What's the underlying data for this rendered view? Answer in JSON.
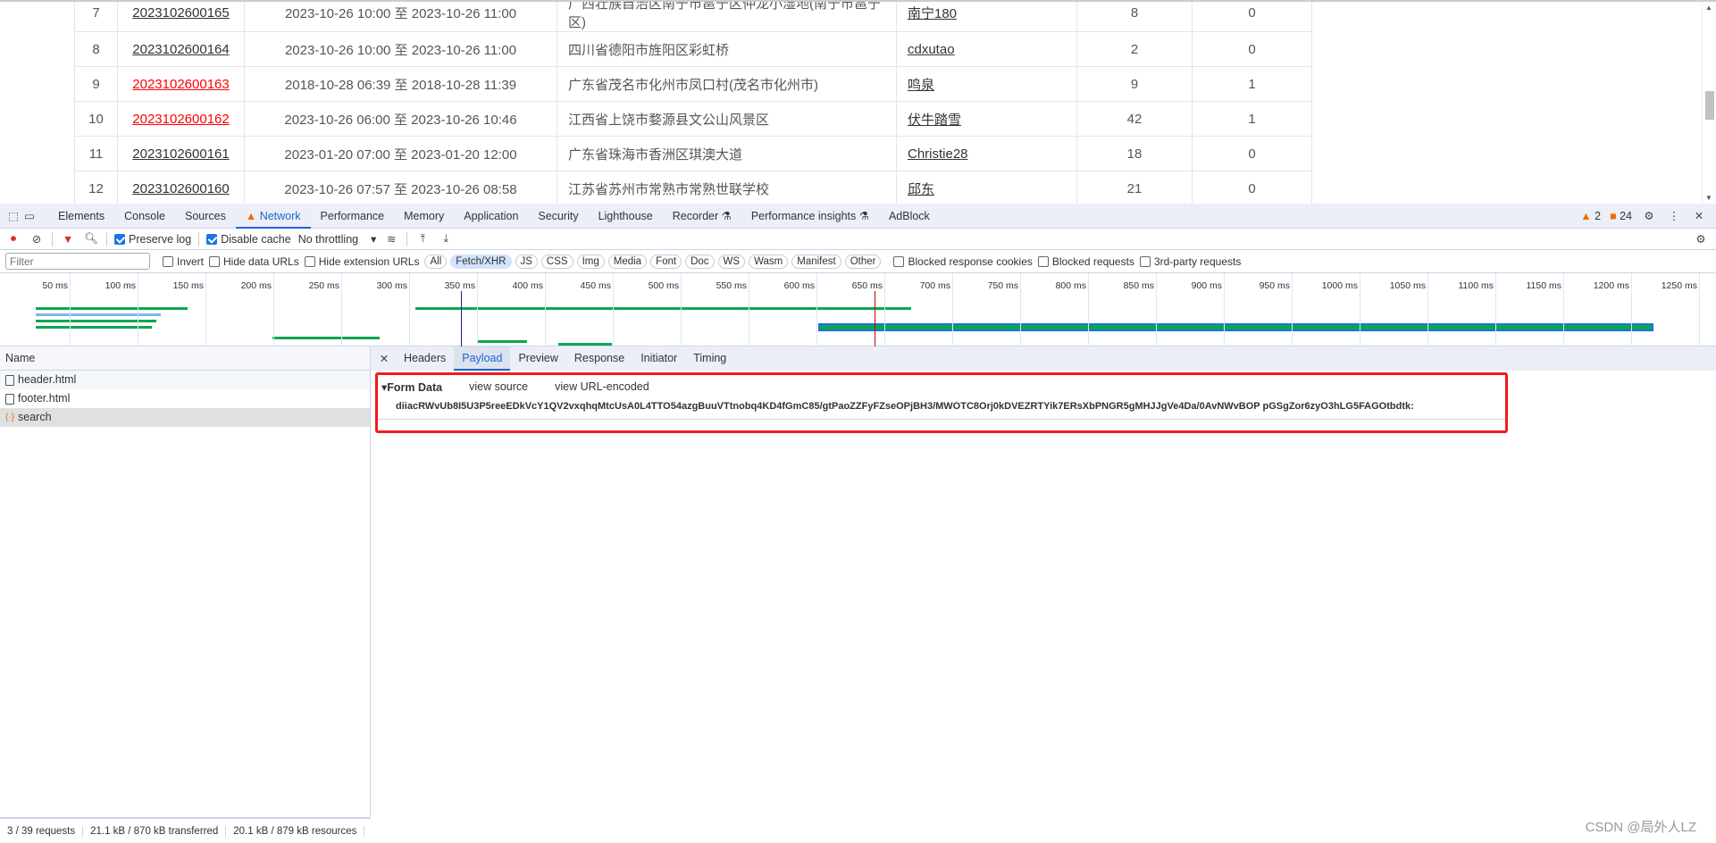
{
  "table": {
    "rows": [
      {
        "no": "7",
        "id": "2023102600165",
        "red": false,
        "time": "2023-10-26 10:00 至 2023-10-26 11:00",
        "addr": "广西壮族自治区南宁市邕宁区仲龙小湿地(南宁市邕宁区)",
        "user": "南宁180",
        "count": "8",
        "flag": "0"
      },
      {
        "no": "8",
        "id": "2023102600164",
        "red": false,
        "time": "2023-10-26 10:00 至 2023-10-26 11:00",
        "addr": "四川省德阳市旌阳区彩虹桥",
        "user": "cdxutao",
        "count": "2",
        "flag": "0"
      },
      {
        "no": "9",
        "id": "2023102600163",
        "red": true,
        "time": "2018-10-28 06:39 至 2018-10-28 11:39",
        "addr": "广东省茂名市化州市凤口村(茂名市化州市)",
        "user": "鸣泉",
        "count": "9",
        "flag": "1"
      },
      {
        "no": "10",
        "id": "2023102600162",
        "red": true,
        "time": "2023-10-26 06:00 至 2023-10-26 10:46",
        "addr": "江西省上饶市婺源县文公山风景区",
        "user": "伏牛踏雪",
        "count": "42",
        "flag": "1"
      },
      {
        "no": "11",
        "id": "2023102600161",
        "red": false,
        "time": "2023-01-20 07:00 至 2023-01-20 12:00",
        "addr": "广东省珠海市香洲区琪澳大道",
        "user": "Christie28",
        "count": "18",
        "flag": "0"
      },
      {
        "no": "12",
        "id": "2023102600160",
        "red": false,
        "time": "2023-10-26 07:57 至 2023-10-26 08:58",
        "addr": "江苏省苏州市常熟市常熟世联学校",
        "user": "邱东",
        "count": "21",
        "flag": "0"
      }
    ]
  },
  "devtools": {
    "tabs": [
      "Elements",
      "Console",
      "Sources",
      "Network",
      "Performance",
      "Memory",
      "Application",
      "Security",
      "Lighthouse",
      "Recorder ⚗",
      "Performance insights ⚗",
      "AdBlock"
    ],
    "active_tab": "Network",
    "warnings": "2",
    "issues": "24",
    "toolbar": {
      "preserve_log": "Preserve log",
      "disable_cache": "Disable cache",
      "throttling": "No throttling"
    },
    "filter": {
      "placeholder": "Filter",
      "invert": "Invert",
      "hide_data": "Hide data URLs",
      "hide_ext": "Hide extension URLs",
      "types": [
        "All",
        "Fetch/XHR",
        "JS",
        "CSS",
        "Img",
        "Media",
        "Font",
        "Doc",
        "WS",
        "Wasm",
        "Manifest",
        "Other"
      ],
      "active_type": "Fetch/XHR",
      "blocked_cookies": "Blocked response cookies",
      "blocked_req": "Blocked requests",
      "third_party": "3rd-party requests"
    },
    "timeline_ticks": [
      "50 ms",
      "100 ms",
      "150 ms",
      "200 ms",
      "250 ms",
      "300 ms",
      "350 ms",
      "400 ms",
      "450 ms",
      "500 ms",
      "550 ms",
      "600 ms",
      "650 ms",
      "700 ms",
      "750 ms",
      "800 ms",
      "850 ms",
      "900 ms",
      "950 ms",
      "1000 ms",
      "1050 ms",
      "1100 ms",
      "1150 ms",
      "1200 ms",
      "1250 ms"
    ],
    "name_header": "Name",
    "requests": [
      "header.html",
      "footer.html",
      "search"
    ],
    "detail_tabs": [
      "Headers",
      "Payload",
      "Preview",
      "Response",
      "Initiator",
      "Timing"
    ],
    "active_detail": "Payload",
    "payload": {
      "title": "▾Form Data",
      "view_source": "view source",
      "view_url": "view URL-encoded",
      "value": "diiacRWvUb8I5U3P5reeEDkVcY1QV2vxqhqMtcUsA0L4TTO54azgBuuVTtnobq4KD4fGmC85/gtPaoZZFyFZseOPjBH3/MWOTC8Orj0kDVEZRTYik7ERsXbPNGR5gMHJJgVe4Da/0AvNWvBOP pGSgZor6zyO3hLG5FAGOtbdtk:"
    },
    "status": [
      "3 / 39 requests",
      "21.1 kB / 870 kB transferred",
      "20.1 kB / 879 kB resources"
    ]
  },
  "watermark": "CSDN @局外人LZ",
  "colors": {
    "accent": "#1a66d2",
    "highlight_box": "#f01c1c",
    "link_red": "#ff0000"
  }
}
